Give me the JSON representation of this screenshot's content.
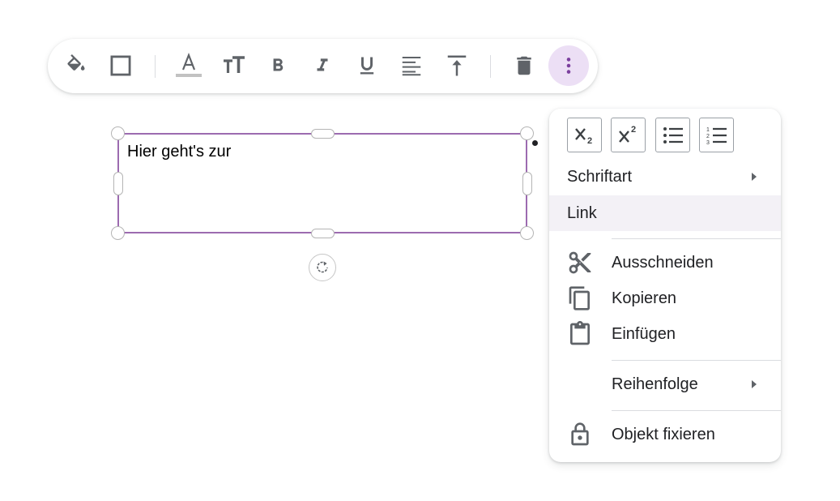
{
  "canvas": {
    "textbox_text": "Hier geht's zur"
  },
  "toolbar": {
    "buttons": [
      {
        "name": "fill-color",
        "icon": "paint-bucket-icon"
      },
      {
        "name": "border",
        "icon": "square-outline-icon"
      },
      {
        "name": "text-color",
        "icon": "text-color-icon"
      },
      {
        "name": "font-size",
        "icon": "font-size-icon"
      },
      {
        "name": "bold",
        "icon": "bold-icon"
      },
      {
        "name": "italic",
        "icon": "italic-icon"
      },
      {
        "name": "underline",
        "icon": "underline-icon"
      },
      {
        "name": "align",
        "icon": "align-left-icon"
      },
      {
        "name": "vertical-align",
        "icon": "vertical-align-top-icon"
      },
      {
        "name": "delete",
        "icon": "trash-icon"
      },
      {
        "name": "more",
        "icon": "more-vertical-icon"
      }
    ]
  },
  "menu": {
    "format_buttons": [
      {
        "name": "subscript",
        "icon": "subscript-icon"
      },
      {
        "name": "superscript",
        "icon": "superscript-icon"
      },
      {
        "name": "bulleted-list",
        "icon": "bullet-list-icon"
      },
      {
        "name": "numbered-list",
        "icon": "numbered-list-icon"
      }
    ],
    "font_label": "Schriftart",
    "link_label": "Link",
    "cut_label": "Ausschneiden",
    "copy_label": "Kopieren",
    "paste_label": "Einfügen",
    "order_label": "Reihenfolge",
    "lock_label": "Objekt fixieren"
  },
  "colors": {
    "accent": "#9c6bb0",
    "active_button_bg": "#ecdff5",
    "icon": "#5f6368",
    "more_icon": "#7b3f9e"
  }
}
